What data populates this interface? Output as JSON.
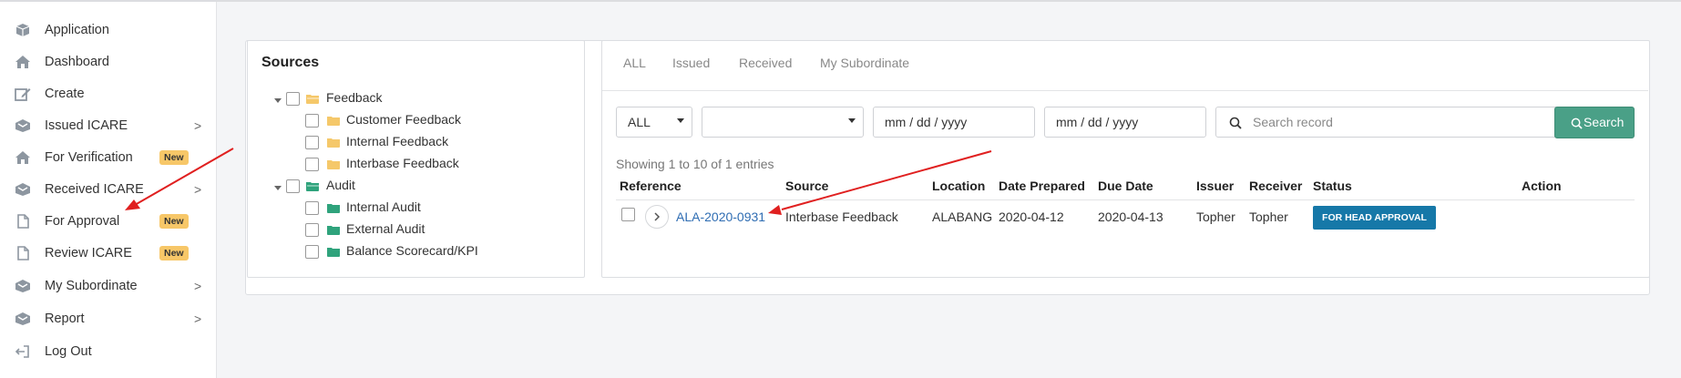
{
  "sidebar": {
    "items": [
      {
        "label": "Application",
        "icon": "package-icon"
      },
      {
        "label": "Dashboard",
        "icon": "home-icon"
      },
      {
        "label": "Create",
        "icon": "edit-icon"
      },
      {
        "label": "Issued ICARE",
        "icon": "inbox-icon",
        "chevron": ">"
      },
      {
        "label": "For Verification",
        "icon": "home-icon",
        "badge": "New"
      },
      {
        "label": "Received ICARE",
        "icon": "inbox-icon",
        "chevron": ">"
      },
      {
        "label": "For Approval",
        "icon": "file-icon",
        "badge": "New"
      },
      {
        "label": "Review ICARE",
        "icon": "file-icon",
        "badge": "New"
      },
      {
        "label": "My Subordinate",
        "icon": "inbox-icon",
        "chevron": ">"
      },
      {
        "label": "Report",
        "icon": "inbox-icon",
        "chevron": ">"
      },
      {
        "label": "Log Out",
        "icon": "logout-icon"
      }
    ]
  },
  "sources": {
    "title": "Sources",
    "groups": [
      {
        "label": "Feedback",
        "color": "#f5c86a",
        "children": [
          "Customer Feedback",
          "Internal Feedback",
          "Interbase Feedback"
        ]
      },
      {
        "label": "Audit",
        "color": "#2fa37c",
        "children": [
          "Internal Audit",
          "External Audit",
          "Balance Scorecard/KPI"
        ]
      }
    ]
  },
  "tabs": [
    "ALL",
    "Issued",
    "Received",
    "My Subordinate"
  ],
  "filters": {
    "type_value": "ALL",
    "source_value": "",
    "date_from_placeholder": "mm / dd / yyyy",
    "date_to_placeholder": "mm / dd / yyyy",
    "search_placeholder": "Search record",
    "search_button": "Search"
  },
  "table": {
    "showing": "Showing 1 to 10 of 1 entries",
    "headers": [
      "Reference",
      "Source",
      "Location",
      "Date Prepared",
      "Due Date",
      "Issuer",
      "Receiver",
      "Status",
      "Action"
    ],
    "rows": [
      {
        "reference": "ALA-2020-0931",
        "source": "Interbase Feedback",
        "location": "ALABANG",
        "date_prepared": "2020-04-12",
        "due_date": "2020-04-13",
        "issuer": "Topher",
        "receiver": "Topher",
        "status": "FOR HEAD APPROVAL"
      }
    ]
  },
  "colors": {
    "accent": "#4aa087",
    "status": "#1678a8",
    "badge": "#f7c768",
    "arrow": "#e02020"
  }
}
